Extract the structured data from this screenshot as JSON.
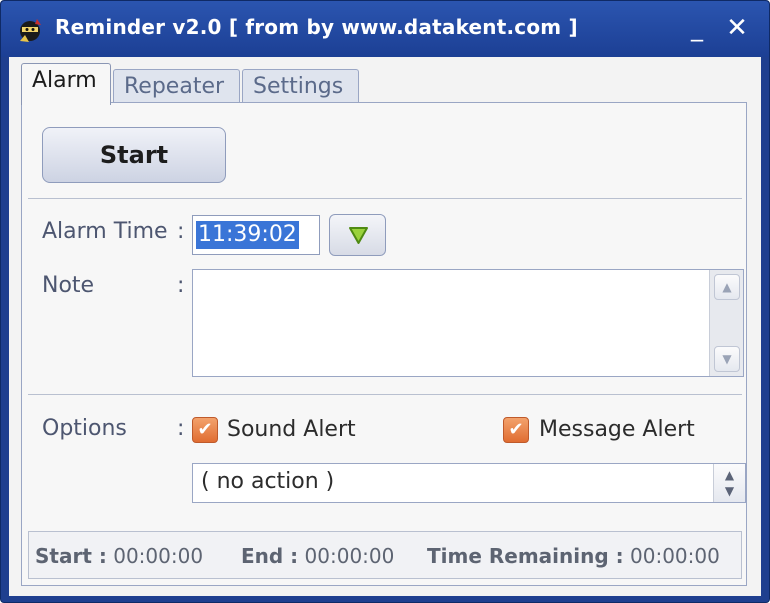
{
  "window": {
    "title": "Reminder v2.0 [ from by www.datakent.com ]",
    "minimize_glyph": "_",
    "close_glyph": "✕"
  },
  "tabs": [
    {
      "label": "Alarm",
      "active": true
    },
    {
      "label": "Repeater",
      "active": false
    },
    {
      "label": "Settings",
      "active": false
    }
  ],
  "alarm": {
    "start_label": "Start",
    "alarm_time_label": "Alarm Time",
    "colon": ":",
    "alarm_time_value": "11:39:02",
    "note_label": "Note",
    "note_value": "",
    "options_label": "Options",
    "sound_alert_label": "Sound Alert",
    "sound_alert_checked": true,
    "message_alert_label": "Message Alert",
    "message_alert_checked": true,
    "action_value": "( no action )"
  },
  "status_bar": {
    "start_label": "Start :",
    "start_value": "00:00:00",
    "end_label": "End :",
    "end_value": "00:00:00",
    "remaining_label": "Time Remaining :",
    "remaining_value": "00:00:00"
  },
  "icons": {
    "app": "ninja-app-icon",
    "dropdown": "green-triangle-down-icon",
    "check": "checkmark-icon"
  },
  "colors": {
    "titlebar": "#1f3f8f",
    "checkbox": "#e06d32",
    "selection": "#3a75d7"
  }
}
